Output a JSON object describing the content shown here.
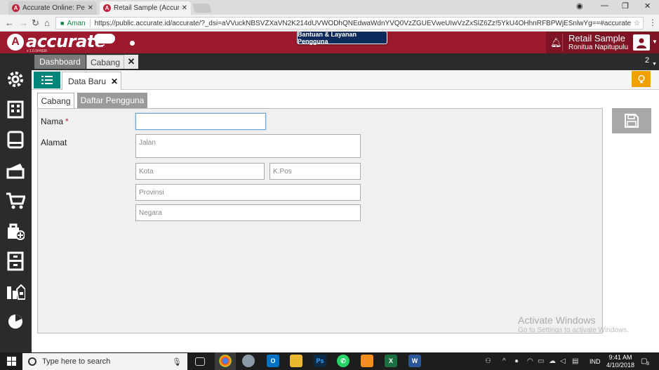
{
  "browser": {
    "tabs": [
      {
        "title": "Accurate Online: Pengatu",
        "close": "✕"
      },
      {
        "title": "Retail Sample (Accurate",
        "close": "✕"
      }
    ],
    "secure_label": "Aman",
    "url": "https://public.accurate.id/accurate/?_dsi=aVVuckNBSVZXaVN2K214dUVWODhQNEdwaWdnYVQ0VzZGUEVweUIwVzZxSlZ6Zz!5YkU4OHhnRFBPWjESnlwYg==#accurate__compa..."
  },
  "app": {
    "brand": "accurate",
    "brand_sub": "online",
    "version": "v 1.0.0#4838",
    "support_button": "Bantuan & Layanan Pengguna",
    "company_name": "Retail Sample",
    "user_name": "Ronitua Napitupulu"
  },
  "module_tabs": {
    "dashboard": "Dashboard",
    "cabang": "Cabang",
    "close": "✕",
    "count": "2"
  },
  "document_tab": {
    "label": "Data Baru",
    "close": "✕"
  },
  "form_tabs": {
    "active": "Cabang",
    "inactive": "Daftar Pengguna"
  },
  "form": {
    "nama_label": "Nama",
    "required_mark": "*",
    "nama_value": "",
    "alamat_label": "Alamat",
    "jalan_placeholder": "Jalan",
    "kota_placeholder": "Kota",
    "kpos_placeholder": "K.Pos",
    "provinsi_placeholder": "Provinsi",
    "negara_placeholder": "Negara"
  },
  "watermark": {
    "line1": "Activate Windows",
    "line2": "Go to Settings to activate Windows."
  },
  "taskbar": {
    "search_placeholder": "Type here to search",
    "language": "IND",
    "time": "9:41 AM",
    "date": "4/10/2018",
    "notifications": "3"
  },
  "colors": {
    "brand": "#9c1a2e",
    "teal": "#00857a",
    "sidebar": "#2b2b2b",
    "tip": "#f0a000"
  }
}
